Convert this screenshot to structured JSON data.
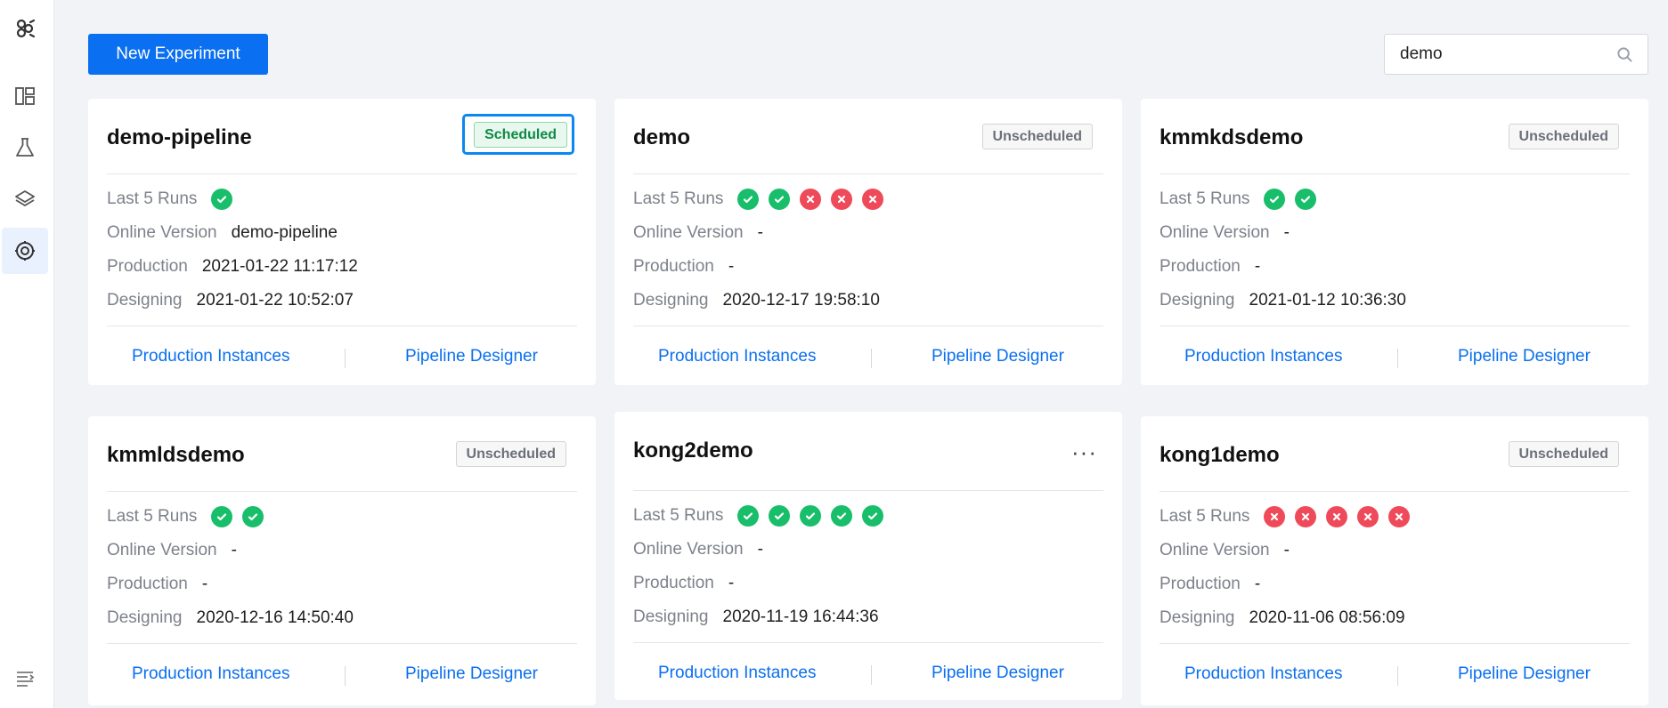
{
  "header": {
    "new_experiment_label": "New Experiment",
    "search": {
      "value": "demo"
    }
  },
  "labels": {
    "last_runs": "Last 5 Runs",
    "online_version": "Online Version",
    "production": "Production",
    "designing": "Designing",
    "production_instances": "Production Instances",
    "pipeline_designer": "Pipeline Designer"
  },
  "colors": {
    "accent": "#0a6ff0",
    "success": "#19be6b",
    "failure": "#ee4a5a",
    "scheduled": "#0e8a45"
  },
  "sidebar": {
    "items": [
      {
        "icon": "logo-icon"
      },
      {
        "icon": "dashboard-icon"
      },
      {
        "icon": "flask-icon"
      },
      {
        "icon": "layers-icon"
      },
      {
        "icon": "pipeline-settings-icon",
        "active": true
      },
      {
        "icon": "collapse-menu-icon"
      }
    ]
  },
  "cards": [
    {
      "title": "demo-pipeline",
      "status": "Scheduled",
      "runs": [
        "success"
      ],
      "online_version": "demo-pipeline",
      "production": "2021-01-22 11:17:12",
      "designing": "2021-01-22 10:52:07"
    },
    {
      "title": "demo",
      "status": "Unscheduled",
      "runs": [
        "success",
        "success",
        "failure",
        "failure",
        "failure"
      ],
      "online_version": "-",
      "production": "-",
      "designing": "2020-12-17 19:58:10"
    },
    {
      "title": "kmmkdsdemo",
      "status": "Unscheduled",
      "runs": [
        "success",
        "success"
      ],
      "online_version": "-",
      "production": "-",
      "designing": "2021-01-12 10:36:30"
    },
    {
      "title": "kmmldsdemo",
      "status": "Unscheduled",
      "runs": [
        "success",
        "success"
      ],
      "online_version": "-",
      "production": "-",
      "designing": "2020-12-16 14:50:40"
    },
    {
      "title": "kong2demo",
      "status": "",
      "runs": [
        "success",
        "success",
        "success",
        "success",
        "success"
      ],
      "online_version": "-",
      "production": "-",
      "designing": "2020-11-19 16:44:36"
    },
    {
      "title": "kong1demo",
      "status": "Unscheduled",
      "runs": [
        "failure",
        "failure",
        "failure",
        "failure",
        "failure"
      ],
      "online_version": "-",
      "production": "-",
      "designing": "2020-11-06 08:56:09"
    }
  ]
}
